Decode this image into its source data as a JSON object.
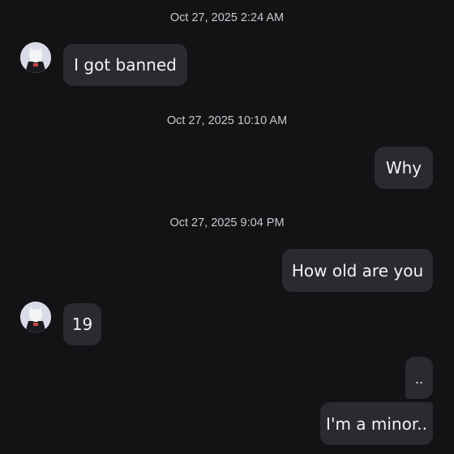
{
  "messages": [
    {
      "timestamp": "Oct 27, 2025 2:24 AM"
    },
    {
      "sender": "incoming",
      "text": "I got banned"
    },
    {
      "timestamp": "Oct 27, 2025 10:10 AM"
    },
    {
      "sender": "outgoing",
      "text": "Why"
    },
    {
      "timestamp": "Oct 27, 2025 9:04 PM"
    },
    {
      "sender": "outgoing",
      "text": "How old are you"
    },
    {
      "sender": "incoming",
      "text": "19"
    },
    {
      "sender": "outgoing",
      "text": ".."
    },
    {
      "sender": "outgoing",
      "text": "I'm a minor.."
    }
  ],
  "avatar": {
    "icon": "anime-character-avatar-icon"
  }
}
